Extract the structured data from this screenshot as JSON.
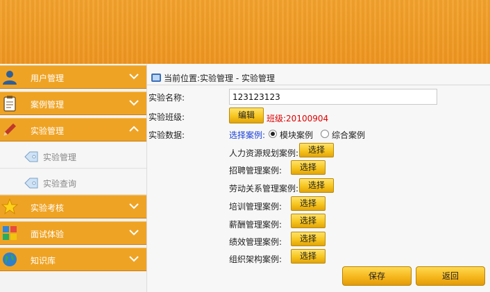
{
  "sidebar": {
    "items": [
      {
        "label": "用户管理",
        "icon": "user-icon",
        "state": "collapsed"
      },
      {
        "label": "案例管理",
        "icon": "clipboard-icon",
        "state": "collapsed"
      },
      {
        "label": "实验管理",
        "icon": "pencil-icon",
        "state": "expanded"
      },
      {
        "label": "实验考核",
        "icon": "star-icon",
        "state": "collapsed"
      },
      {
        "label": "面试体验",
        "icon": "puzzle-icon",
        "state": "collapsed"
      },
      {
        "label": "知识库",
        "icon": "globe-icon",
        "state": "collapsed"
      }
    ],
    "subitems": [
      {
        "label": "实验管理",
        "icon": "tag-icon"
      },
      {
        "label": "实验查询",
        "icon": "tag-icon"
      }
    ]
  },
  "breadcrumb": {
    "text": "当前位置:实验管理 - 实验管理"
  },
  "form": {
    "name_label": "实验名称:",
    "name_value": "123123123",
    "class_label": "实验班级:",
    "edit_button": "编辑",
    "class_text": "班级:20100904",
    "data_label": "实验数据:",
    "select_case_label": "选择案例:",
    "radio_options": [
      {
        "label": "模块案例",
        "selected": true
      },
      {
        "label": "综合案例",
        "selected": false
      }
    ],
    "cases": [
      {
        "label": "人力资源规划案例:",
        "button": "选择"
      },
      {
        "label": "招聘管理案例:",
        "button": "选择"
      },
      {
        "label": "劳动关系管理案例:",
        "button": "选择"
      },
      {
        "label": "培训管理案例:",
        "button": "选择"
      },
      {
        "label": "薪酬管理案例:",
        "button": "选择"
      },
      {
        "label": "绩效管理案例:",
        "button": "选择"
      },
      {
        "label": "组织架构案例:",
        "button": "选择"
      }
    ],
    "save_button": "保存",
    "back_button": "返回"
  },
  "colors": {
    "accent": "#efa324",
    "danger_text": "#e00000",
    "link_blue": "#1a3fd6"
  }
}
